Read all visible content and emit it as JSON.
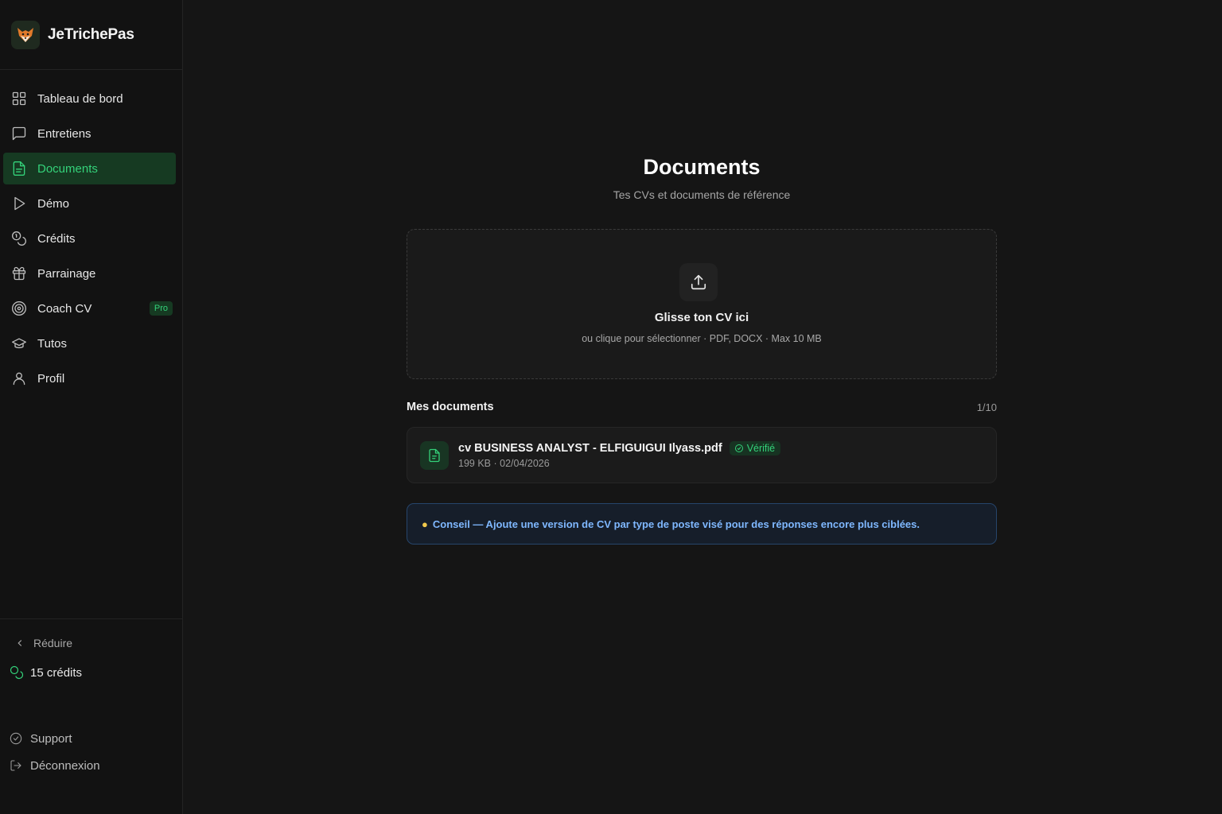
{
  "brand": {
    "name": "JeTrichePas",
    "logo_icon": "fox-icon"
  },
  "sidebar": {
    "items": [
      {
        "label": "Tableau de bord",
        "icon": "grid-icon",
        "active": false
      },
      {
        "label": "Entretiens",
        "icon": "message-square-icon",
        "active": false
      },
      {
        "label": "Documents",
        "icon": "file-text-icon",
        "active": true
      },
      {
        "label": "Démo",
        "icon": "play-icon",
        "active": false
      },
      {
        "label": "Crédits",
        "icon": "coins-icon",
        "active": false
      },
      {
        "label": "Parrainage",
        "icon": "gift-icon",
        "active": false
      },
      {
        "label": "Coach CV",
        "icon": "target-icon",
        "active": false,
        "badge": "Pro"
      },
      {
        "label": "Tutos",
        "icon": "graduation-cap-icon",
        "active": false
      },
      {
        "label": "Profil",
        "icon": "user-icon",
        "active": false
      }
    ],
    "reduce_label": "Réduire",
    "credits_label": "15 crédits",
    "support_label": "Support",
    "logout_label": "Déconnexion"
  },
  "main": {
    "title": "Documents",
    "subtitle": "Tes CVs et documents de référence",
    "dropzone": {
      "title": "Glisse ton CV ici",
      "subtitle": "ou clique pour sélectionner · PDF, DOCX · Max 10 MB"
    },
    "documents": {
      "title": "Mes documents",
      "count": "1/10",
      "items": [
        {
          "name": "cv BUSINESS ANALYST - ELFIGUIGUI Ilyass.pdf",
          "status": "Vérifié",
          "meta": "199 KB · 02/04/2026"
        }
      ]
    },
    "tip": "Conseil — Ajoute une version de CV par type de poste visé pour des réponses encore plus ciblées."
  },
  "colors": {
    "background": "#141414",
    "sidebar_bg": "#121212",
    "accent_green": "#34d27a",
    "active_bg": "#163a22",
    "tip_text": "#7fb8ff",
    "tip_border": "#26456b"
  }
}
